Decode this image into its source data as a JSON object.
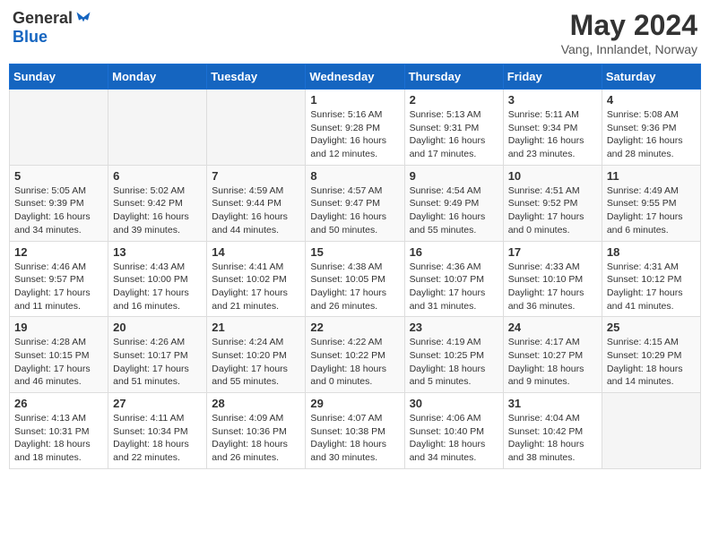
{
  "header": {
    "logo_general": "General",
    "logo_blue": "Blue",
    "month_year": "May 2024",
    "location": "Vang, Innlandet, Norway"
  },
  "weekdays": [
    "Sunday",
    "Monday",
    "Tuesday",
    "Wednesday",
    "Thursday",
    "Friday",
    "Saturday"
  ],
  "weeks": [
    [
      {
        "day": "",
        "info": ""
      },
      {
        "day": "",
        "info": ""
      },
      {
        "day": "",
        "info": ""
      },
      {
        "day": "1",
        "info": "Sunrise: 5:16 AM\nSunset: 9:28 PM\nDaylight: 16 hours\nand 12 minutes."
      },
      {
        "day": "2",
        "info": "Sunrise: 5:13 AM\nSunset: 9:31 PM\nDaylight: 16 hours\nand 17 minutes."
      },
      {
        "day": "3",
        "info": "Sunrise: 5:11 AM\nSunset: 9:34 PM\nDaylight: 16 hours\nand 23 minutes."
      },
      {
        "day": "4",
        "info": "Sunrise: 5:08 AM\nSunset: 9:36 PM\nDaylight: 16 hours\nand 28 minutes."
      }
    ],
    [
      {
        "day": "5",
        "info": "Sunrise: 5:05 AM\nSunset: 9:39 PM\nDaylight: 16 hours\nand 34 minutes."
      },
      {
        "day": "6",
        "info": "Sunrise: 5:02 AM\nSunset: 9:42 PM\nDaylight: 16 hours\nand 39 minutes."
      },
      {
        "day": "7",
        "info": "Sunrise: 4:59 AM\nSunset: 9:44 PM\nDaylight: 16 hours\nand 44 minutes."
      },
      {
        "day": "8",
        "info": "Sunrise: 4:57 AM\nSunset: 9:47 PM\nDaylight: 16 hours\nand 50 minutes."
      },
      {
        "day": "9",
        "info": "Sunrise: 4:54 AM\nSunset: 9:49 PM\nDaylight: 16 hours\nand 55 minutes."
      },
      {
        "day": "10",
        "info": "Sunrise: 4:51 AM\nSunset: 9:52 PM\nDaylight: 17 hours\nand 0 minutes."
      },
      {
        "day": "11",
        "info": "Sunrise: 4:49 AM\nSunset: 9:55 PM\nDaylight: 17 hours\nand 6 minutes."
      }
    ],
    [
      {
        "day": "12",
        "info": "Sunrise: 4:46 AM\nSunset: 9:57 PM\nDaylight: 17 hours\nand 11 minutes."
      },
      {
        "day": "13",
        "info": "Sunrise: 4:43 AM\nSunset: 10:00 PM\nDaylight: 17 hours\nand 16 minutes."
      },
      {
        "day": "14",
        "info": "Sunrise: 4:41 AM\nSunset: 10:02 PM\nDaylight: 17 hours\nand 21 minutes."
      },
      {
        "day": "15",
        "info": "Sunrise: 4:38 AM\nSunset: 10:05 PM\nDaylight: 17 hours\nand 26 minutes."
      },
      {
        "day": "16",
        "info": "Sunrise: 4:36 AM\nSunset: 10:07 PM\nDaylight: 17 hours\nand 31 minutes."
      },
      {
        "day": "17",
        "info": "Sunrise: 4:33 AM\nSunset: 10:10 PM\nDaylight: 17 hours\nand 36 minutes."
      },
      {
        "day": "18",
        "info": "Sunrise: 4:31 AM\nSunset: 10:12 PM\nDaylight: 17 hours\nand 41 minutes."
      }
    ],
    [
      {
        "day": "19",
        "info": "Sunrise: 4:28 AM\nSunset: 10:15 PM\nDaylight: 17 hours\nand 46 minutes."
      },
      {
        "day": "20",
        "info": "Sunrise: 4:26 AM\nSunset: 10:17 PM\nDaylight: 17 hours\nand 51 minutes."
      },
      {
        "day": "21",
        "info": "Sunrise: 4:24 AM\nSunset: 10:20 PM\nDaylight: 17 hours\nand 55 minutes."
      },
      {
        "day": "22",
        "info": "Sunrise: 4:22 AM\nSunset: 10:22 PM\nDaylight: 18 hours\nand 0 minutes."
      },
      {
        "day": "23",
        "info": "Sunrise: 4:19 AM\nSunset: 10:25 PM\nDaylight: 18 hours\nand 5 minutes."
      },
      {
        "day": "24",
        "info": "Sunrise: 4:17 AM\nSunset: 10:27 PM\nDaylight: 18 hours\nand 9 minutes."
      },
      {
        "day": "25",
        "info": "Sunrise: 4:15 AM\nSunset: 10:29 PM\nDaylight: 18 hours\nand 14 minutes."
      }
    ],
    [
      {
        "day": "26",
        "info": "Sunrise: 4:13 AM\nSunset: 10:31 PM\nDaylight: 18 hours\nand 18 minutes."
      },
      {
        "day": "27",
        "info": "Sunrise: 4:11 AM\nSunset: 10:34 PM\nDaylight: 18 hours\nand 22 minutes."
      },
      {
        "day": "28",
        "info": "Sunrise: 4:09 AM\nSunset: 10:36 PM\nDaylight: 18 hours\nand 26 minutes."
      },
      {
        "day": "29",
        "info": "Sunrise: 4:07 AM\nSunset: 10:38 PM\nDaylight: 18 hours\nand 30 minutes."
      },
      {
        "day": "30",
        "info": "Sunrise: 4:06 AM\nSunset: 10:40 PM\nDaylight: 18 hours\nand 34 minutes."
      },
      {
        "day": "31",
        "info": "Sunrise: 4:04 AM\nSunset: 10:42 PM\nDaylight: 18 hours\nand 38 minutes."
      },
      {
        "day": "",
        "info": ""
      }
    ]
  ]
}
